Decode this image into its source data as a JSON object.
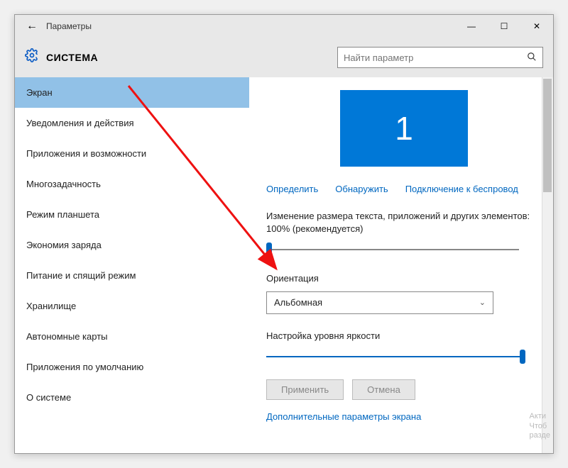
{
  "window": {
    "title": "Параметры"
  },
  "header": {
    "title": "СИСТЕМА",
    "search_placeholder": "Найти параметр"
  },
  "sidebar": {
    "items": [
      {
        "label": "Экран",
        "selected": true
      },
      {
        "label": "Уведомления и действия"
      },
      {
        "label": "Приложения и возможности"
      },
      {
        "label": "Многозадачность"
      },
      {
        "label": "Режим планшета"
      },
      {
        "label": "Экономия заряда"
      },
      {
        "label": "Питание и спящий режим"
      },
      {
        "label": "Хранилище"
      },
      {
        "label": "Автономные карты"
      },
      {
        "label": "Приложения по умолчанию"
      },
      {
        "label": "О системе"
      }
    ]
  },
  "content": {
    "monitor_number": "1",
    "links": {
      "identify": "Определить",
      "detect": "Обнаружить",
      "wireless": "Подключение к беспровод"
    },
    "scale_label": "Изменение размера текста, приложений и других элементов: 100% (рекомендуется)",
    "orientation_label": "Ориентация",
    "orientation_value": "Альбомная",
    "brightness_label": "Настройка уровня яркости",
    "apply_btn": "Применить",
    "cancel_btn": "Отмена",
    "advanced_link": "Дополнительные параметры экрана"
  },
  "watermark": {
    "line1": "Акти",
    "line2": "Чтоб",
    "line3": "разде"
  },
  "colors": {
    "accent": "#0078d7",
    "link": "#0067c0",
    "selected_nav": "#91c1e7"
  }
}
